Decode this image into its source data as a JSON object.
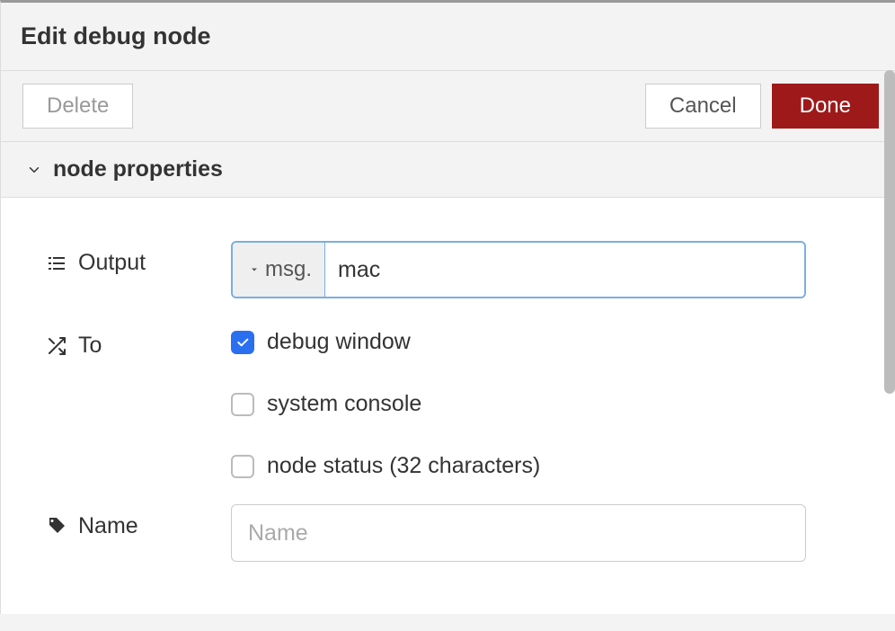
{
  "header": {
    "title": "Edit debug node"
  },
  "toolbar": {
    "delete_label": "Delete",
    "cancel_label": "Cancel",
    "done_label": "Done"
  },
  "section": {
    "title": "node properties"
  },
  "form": {
    "output": {
      "label": "Output",
      "prefix": "msg.",
      "value": "mac"
    },
    "to": {
      "label": "To",
      "options": [
        {
          "label": "debug window",
          "checked": true
        },
        {
          "label": "system console",
          "checked": false
        },
        {
          "label": "node status (32 characters)",
          "checked": false
        }
      ]
    },
    "name": {
      "label": "Name",
      "placeholder": "Name",
      "value": ""
    }
  }
}
